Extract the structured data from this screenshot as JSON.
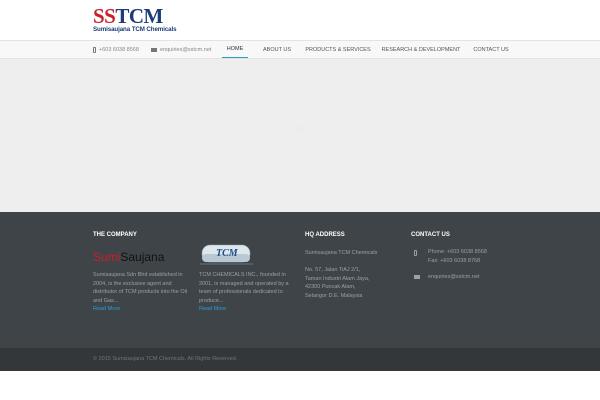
{
  "header": {
    "logo_main_s": "SS",
    "logo_main_t": "TCM",
    "logo_sub": "Sumisaujana TCM Chemicals"
  },
  "topbar": {
    "phone": "+603 6038 8568",
    "email": "enquiries@sstcm.net"
  },
  "nav": {
    "items": [
      {
        "label": "HOME",
        "active": true
      },
      {
        "label": "ABOUT US"
      },
      {
        "label": "PRODUCTS & SERVICES"
      },
      {
        "label": "RESEARCH & DEVELOPMENT"
      },
      {
        "label": "CONTACT US"
      }
    ]
  },
  "footer": {
    "company": {
      "title": "THE COMPANY",
      "logo1_a": "Sumi",
      "logo1_b": "Saujana",
      "text1": "Sumisaujana Sdn Bhd established in 2004, is the exclusive agent and distributor of TCM products into the Oil and Gas...",
      "readmore1": "Read More",
      "logo2": "TCM",
      "text2": "TCM CHEMICALS INC., founded in 2001, is managed and operated by a team of professionals dedicated to produce...",
      "readmore2": "Read More"
    },
    "hq": {
      "title": "HQ ADDRESS",
      "name": "Sumisaujana TCM Chemicals",
      "address_lines": [
        "No. 57, Jalan TiAJ 2/1,",
        "Taman Industri Alam Jaya,",
        "42300 Puncak Alam,",
        "Selangor D.E. Malaysia"
      ]
    },
    "contact": {
      "title": "CONTACT US",
      "phone": "Phone: +603 6038 8568",
      "fax": "Fax: +603 6038 8768",
      "email": "enquiries@sstcm.net"
    },
    "copyright": "© 2015 Sumisaujana TCM Chemicals. All Rights Reserved."
  },
  "colors": {
    "accent": "#2aa0b8",
    "brand_red": "#c8202a",
    "brand_blue": "#1d3a7a",
    "footer_bg": "#3f4448",
    "bottom_bg": "#333739"
  },
  "icons": [
    "phone-icon",
    "mail-icon"
  ]
}
